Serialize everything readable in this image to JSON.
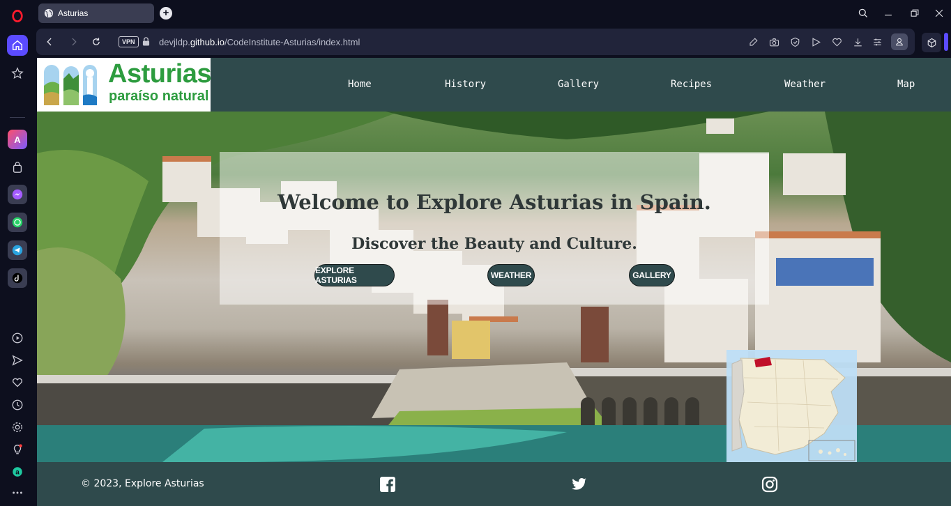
{
  "browser": {
    "tab_title": "Asturias",
    "vpn_label": "VPN",
    "url_prefix": "devjldp.",
    "url_domain": "github.io",
    "url_path": "/CodeInstitute-Asturias/index.html",
    "sidebar_icons": [
      "opera-logo-icon",
      "home-icon",
      "star-icon",
      "aria-icon",
      "shopping-bag-icon",
      "messenger-icon",
      "whatsapp-icon",
      "telegram-icon",
      "tiktok-icon",
      "player-icon",
      "send-icon",
      "heart-icon",
      "history-icon",
      "settings-icon",
      "lightbulb-icon",
      "amazon-icon",
      "more-icon"
    ],
    "toolbar_icons": [
      "edit-icon",
      "camera-icon",
      "shield-icon",
      "flow-icon",
      "heart-icon",
      "download-icon",
      "easy-setup-icon",
      "profile-icon",
      "extensions-icon"
    ],
    "accent_color": "#5b4bff"
  },
  "site": {
    "logo": {
      "main": "Asturias",
      "sub": "paraíso natural"
    },
    "nav": [
      "Home",
      "History",
      "Gallery",
      "Recipes",
      "Weather",
      "Map"
    ],
    "hero": {
      "title": "Welcome to Explore Asturias in Spain.",
      "subtitle": "Discover the Beauty and Culture.",
      "buttons": [
        "EXPLORE ASTURIAS",
        "WEATHER",
        "GALLERY"
      ]
    },
    "footer": {
      "copyright": "© 2023, Explore Asturias",
      "social": [
        "facebook-icon",
        "twitter-icon",
        "instagram-icon"
      ]
    },
    "colors": {
      "primary": "#2f4a4c",
      "logo_green": "#2d9c3f",
      "map_highlight": "#c0102a"
    }
  }
}
